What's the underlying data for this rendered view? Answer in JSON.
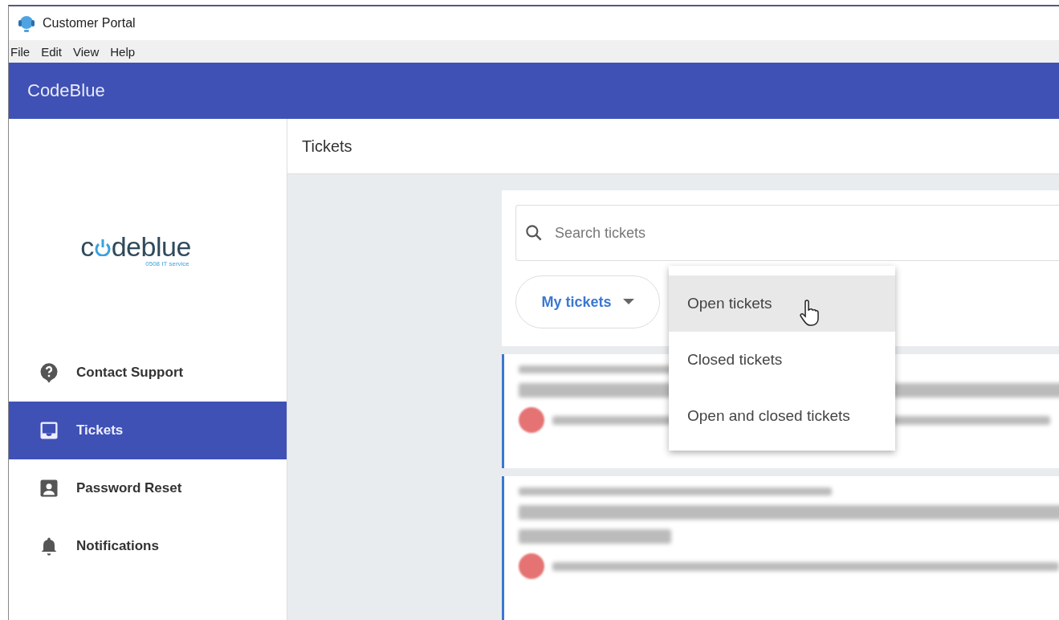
{
  "window": {
    "title": "Customer Portal"
  },
  "menu_bar": [
    "File",
    "Edit",
    "View",
    "Help"
  ],
  "app_bar": {
    "title": "CodeBlue"
  },
  "sidebar": {
    "logo": {
      "before": "c",
      "after": "deblue",
      "tagline": "0508 IT service"
    },
    "items": [
      {
        "label": "Contact Support",
        "selected": false
      },
      {
        "label": "Tickets",
        "selected": true
      },
      {
        "label": "Password Reset",
        "selected": false
      },
      {
        "label": "Notifications",
        "selected": false
      }
    ]
  },
  "page": {
    "title": "Tickets"
  },
  "search": {
    "placeholder": "Search tickets"
  },
  "filter": {
    "label": "My tickets"
  },
  "dropdown": {
    "items": [
      {
        "label": "Open tickets",
        "selected": true
      },
      {
        "label": "Closed tickets",
        "selected": false
      },
      {
        "label": "Open and closed tickets",
        "selected": false
      }
    ]
  }
}
